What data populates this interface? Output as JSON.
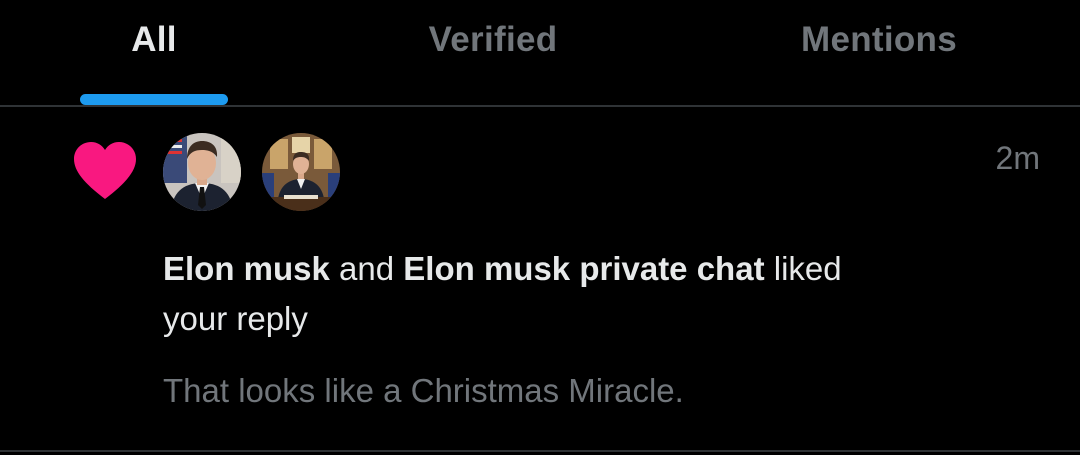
{
  "tabs": [
    {
      "label": "All",
      "active": true
    },
    {
      "label": "Verified",
      "active": false
    },
    {
      "label": "Mentions",
      "active": false
    }
  ],
  "colors": {
    "background": "#000000",
    "accent": "#1d9bf0",
    "like": "#f91880",
    "text_primary": "#e7e9ea",
    "text_secondary": "#71767b",
    "divider": "#2f3336"
  },
  "notification": {
    "type_icon": "heart-icon",
    "avatars": [
      "avatar-user-1",
      "avatar-user-2"
    ],
    "timestamp": "2m",
    "actor_1": "Elon musk",
    "conjunction": "and",
    "actor_2": "Elon musk private chat",
    "action_line_1": "liked",
    "action_line_2": "your reply",
    "preview": "That looks like a Christmas Miracle."
  }
}
